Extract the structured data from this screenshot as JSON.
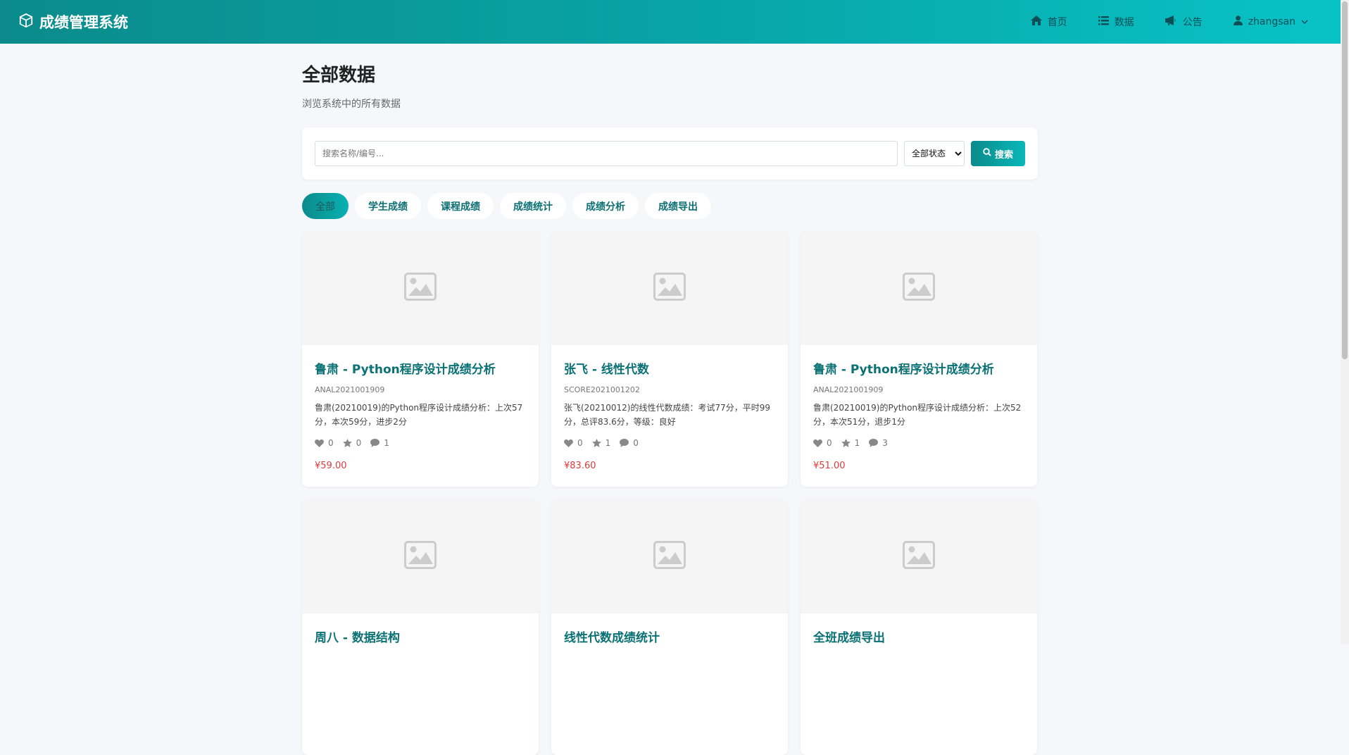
{
  "navbar": {
    "brand": "成绩管理系统",
    "links": [
      {
        "icon": "home-icon",
        "label": "首页"
      },
      {
        "icon": "list-icon",
        "label": "数据"
      },
      {
        "icon": "megaphone-icon",
        "label": "公告"
      }
    ],
    "user": {
      "icon": "user-icon",
      "label": "zhangsan"
    }
  },
  "page": {
    "title": "全部数据",
    "subtitle": "浏览系统中的所有数据"
  },
  "search": {
    "placeholder": "搜索名称/编号...",
    "status_selected": "全部状态",
    "button_label": "搜索"
  },
  "tabs": [
    {
      "label": "全部",
      "active": true
    },
    {
      "label": "学生成绩"
    },
    {
      "label": "课程成绩"
    },
    {
      "label": "成绩统计"
    },
    {
      "label": "成绩分析"
    },
    {
      "label": "成绩导出"
    }
  ],
  "cards": [
    {
      "title": "鲁肃 - Python程序设计成绩分析",
      "code": "ANAL2021001909",
      "desc": "鲁肃(20210019)的Python程序设计成绩分析：上次57分，本次59分，进步2分",
      "likes": "0",
      "favorites": "0",
      "comments": "1",
      "price": "¥59.00"
    },
    {
      "title": "张飞 - 线性代数",
      "code": "SCORE2021001202",
      "desc": "张飞(20210012)的线性代数成绩：考试77分，平时99分，总评83.6分，等级：良好",
      "likes": "0",
      "favorites": "1",
      "comments": "0",
      "price": "¥83.60"
    },
    {
      "title": "鲁肃 - Python程序设计成绩分析",
      "code": "ANAL2021001909",
      "desc": "鲁肃(20210019)的Python程序设计成绩分析：上次52分，本次51分，退步1分",
      "likes": "0",
      "favorites": "1",
      "comments": "3",
      "price": "¥51.00"
    },
    {
      "title": "周八 - 数据结构"
    },
    {
      "title": "线性代数成绩统计"
    },
    {
      "title": "全班成绩导出"
    }
  ]
}
